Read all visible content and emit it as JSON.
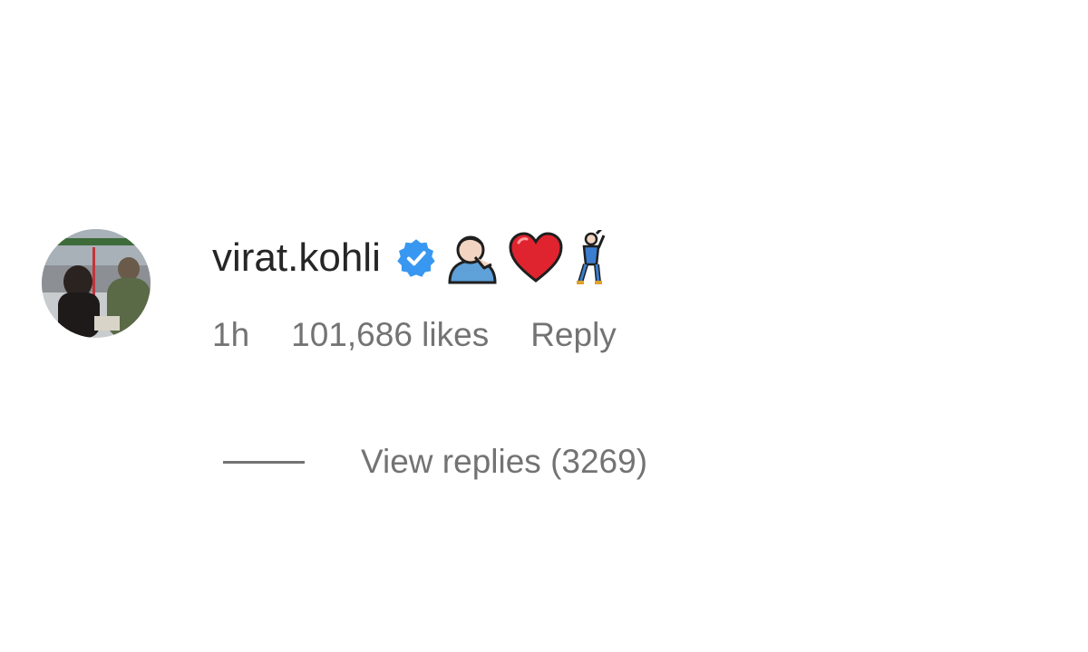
{
  "comment": {
    "username": "virat.kohli",
    "verified": true,
    "emojis": [
      "person-with-hand-on-cheek-emoji",
      "red-heart-emoji",
      "man-dancing-emoji"
    ],
    "time": "1h",
    "likes": "101,686 likes",
    "reply_label": "Reply",
    "view_replies_label": "View replies (3269)"
  },
  "colors": {
    "text_primary": "#262626",
    "text_secondary": "#737373",
    "verified_blue": "#3897f0",
    "heart_red": "#e0242f"
  }
}
